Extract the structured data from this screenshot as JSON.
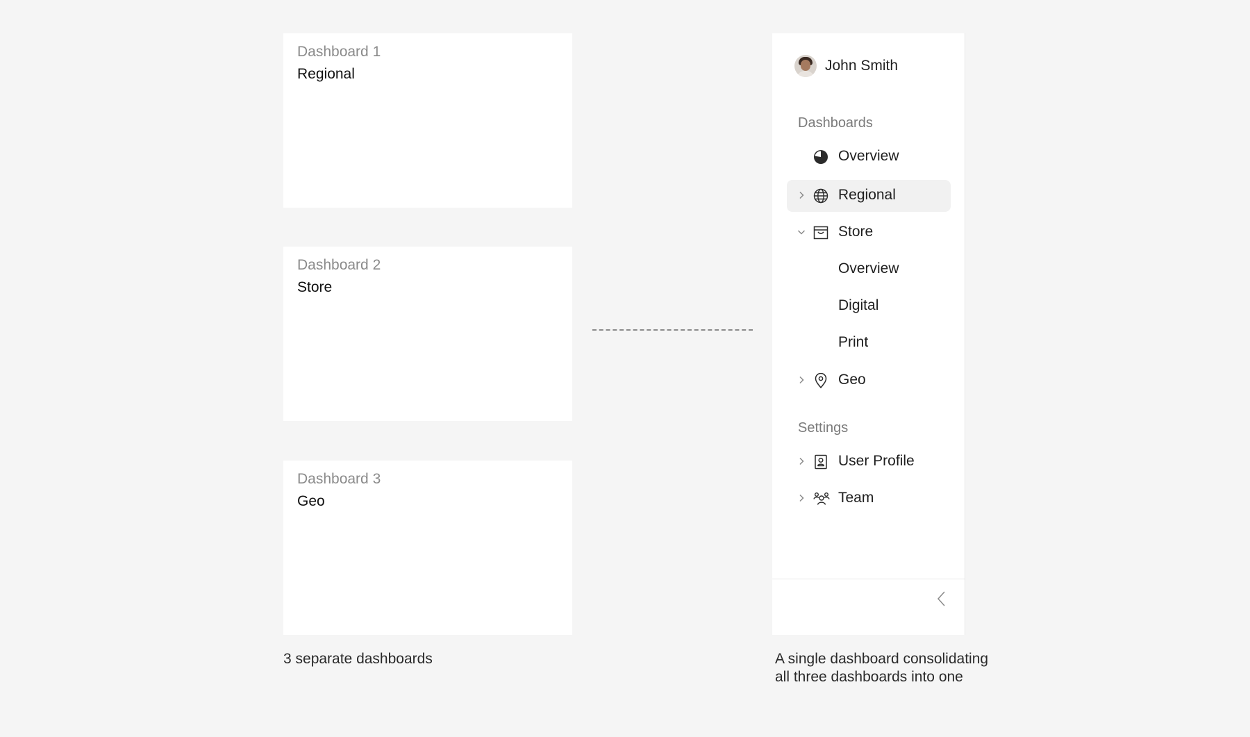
{
  "cards": [
    {
      "num": "Dashboard 1",
      "name": "Regional"
    },
    {
      "num": "Dashboard 2",
      "name": "Store"
    },
    {
      "num": "Dashboard 3",
      "name": "Geo"
    }
  ],
  "captions": {
    "left": "3 separate dashboards",
    "right_line1": "A single dashboard consolidating",
    "right_line2": "all three dashboards into one"
  },
  "sidebar": {
    "user_name": "John Smith",
    "sections": {
      "dashboards": "Dashboards",
      "settings": "Settings"
    },
    "items": [
      {
        "label": "Overview",
        "icon": "pie-chart-icon"
      },
      {
        "label": "Regional",
        "icon": "globe-icon",
        "active": true
      },
      {
        "label": "Store",
        "icon": "store-icon",
        "expanded": true
      },
      {
        "label": "Overview"
      },
      {
        "label": "Digital"
      },
      {
        "label": "Print"
      },
      {
        "label": "Geo",
        "icon": "map-pin-icon"
      },
      {
        "label": "User Profile",
        "icon": "user-card-icon"
      },
      {
        "label": "Team",
        "icon": "team-icon"
      }
    ]
  },
  "colors": {
    "background": "#f5f5f5",
    "panel": "#ffffff",
    "active_item": "#f1f1f1",
    "muted_text": "#8a8a8a"
  }
}
